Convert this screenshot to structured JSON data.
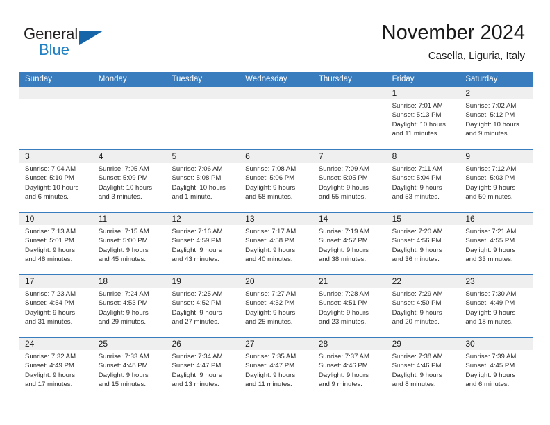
{
  "brand": {
    "name_part1": "General",
    "name_part2": "Blue",
    "logo_icon": "triangle-flag-icon"
  },
  "header": {
    "month_title": "November 2024",
    "location": "Casella, Liguria, Italy"
  },
  "theme": {
    "header_blue": "#3a7dbf",
    "brand_blue": "#1f7fc4",
    "day_band_gray": "#efefef"
  },
  "weekdays": [
    "Sunday",
    "Monday",
    "Tuesday",
    "Wednesday",
    "Thursday",
    "Friday",
    "Saturday"
  ],
  "weeks": [
    [
      {
        "day": "",
        "sunrise": "",
        "sunset": "",
        "daylight_line1": "",
        "daylight_line2": ""
      },
      {
        "day": "",
        "sunrise": "",
        "sunset": "",
        "daylight_line1": "",
        "daylight_line2": ""
      },
      {
        "day": "",
        "sunrise": "",
        "sunset": "",
        "daylight_line1": "",
        "daylight_line2": ""
      },
      {
        "day": "",
        "sunrise": "",
        "sunset": "",
        "daylight_line1": "",
        "daylight_line2": ""
      },
      {
        "day": "",
        "sunrise": "",
        "sunset": "",
        "daylight_line1": "",
        "daylight_line2": ""
      },
      {
        "day": "1",
        "sunrise": "Sunrise: 7:01 AM",
        "sunset": "Sunset: 5:13 PM",
        "daylight_line1": "Daylight: 10 hours",
        "daylight_line2": "and 11 minutes."
      },
      {
        "day": "2",
        "sunrise": "Sunrise: 7:02 AM",
        "sunset": "Sunset: 5:12 PM",
        "daylight_line1": "Daylight: 10 hours",
        "daylight_line2": "and 9 minutes."
      }
    ],
    [
      {
        "day": "3",
        "sunrise": "Sunrise: 7:04 AM",
        "sunset": "Sunset: 5:10 PM",
        "daylight_line1": "Daylight: 10 hours",
        "daylight_line2": "and 6 minutes."
      },
      {
        "day": "4",
        "sunrise": "Sunrise: 7:05 AM",
        "sunset": "Sunset: 5:09 PM",
        "daylight_line1": "Daylight: 10 hours",
        "daylight_line2": "and 3 minutes."
      },
      {
        "day": "5",
        "sunrise": "Sunrise: 7:06 AM",
        "sunset": "Sunset: 5:08 PM",
        "daylight_line1": "Daylight: 10 hours",
        "daylight_line2": "and 1 minute."
      },
      {
        "day": "6",
        "sunrise": "Sunrise: 7:08 AM",
        "sunset": "Sunset: 5:06 PM",
        "daylight_line1": "Daylight: 9 hours",
        "daylight_line2": "and 58 minutes."
      },
      {
        "day": "7",
        "sunrise": "Sunrise: 7:09 AM",
        "sunset": "Sunset: 5:05 PM",
        "daylight_line1": "Daylight: 9 hours",
        "daylight_line2": "and 55 minutes."
      },
      {
        "day": "8",
        "sunrise": "Sunrise: 7:11 AM",
        "sunset": "Sunset: 5:04 PM",
        "daylight_line1": "Daylight: 9 hours",
        "daylight_line2": "and 53 minutes."
      },
      {
        "day": "9",
        "sunrise": "Sunrise: 7:12 AM",
        "sunset": "Sunset: 5:03 PM",
        "daylight_line1": "Daylight: 9 hours",
        "daylight_line2": "and 50 minutes."
      }
    ],
    [
      {
        "day": "10",
        "sunrise": "Sunrise: 7:13 AM",
        "sunset": "Sunset: 5:01 PM",
        "daylight_line1": "Daylight: 9 hours",
        "daylight_line2": "and 48 minutes."
      },
      {
        "day": "11",
        "sunrise": "Sunrise: 7:15 AM",
        "sunset": "Sunset: 5:00 PM",
        "daylight_line1": "Daylight: 9 hours",
        "daylight_line2": "and 45 minutes."
      },
      {
        "day": "12",
        "sunrise": "Sunrise: 7:16 AM",
        "sunset": "Sunset: 4:59 PM",
        "daylight_line1": "Daylight: 9 hours",
        "daylight_line2": "and 43 minutes."
      },
      {
        "day": "13",
        "sunrise": "Sunrise: 7:17 AM",
        "sunset": "Sunset: 4:58 PM",
        "daylight_line1": "Daylight: 9 hours",
        "daylight_line2": "and 40 minutes."
      },
      {
        "day": "14",
        "sunrise": "Sunrise: 7:19 AM",
        "sunset": "Sunset: 4:57 PM",
        "daylight_line1": "Daylight: 9 hours",
        "daylight_line2": "and 38 minutes."
      },
      {
        "day": "15",
        "sunrise": "Sunrise: 7:20 AM",
        "sunset": "Sunset: 4:56 PM",
        "daylight_line1": "Daylight: 9 hours",
        "daylight_line2": "and 36 minutes."
      },
      {
        "day": "16",
        "sunrise": "Sunrise: 7:21 AM",
        "sunset": "Sunset: 4:55 PM",
        "daylight_line1": "Daylight: 9 hours",
        "daylight_line2": "and 33 minutes."
      }
    ],
    [
      {
        "day": "17",
        "sunrise": "Sunrise: 7:23 AM",
        "sunset": "Sunset: 4:54 PM",
        "daylight_line1": "Daylight: 9 hours",
        "daylight_line2": "and 31 minutes."
      },
      {
        "day": "18",
        "sunrise": "Sunrise: 7:24 AM",
        "sunset": "Sunset: 4:53 PM",
        "daylight_line1": "Daylight: 9 hours",
        "daylight_line2": "and 29 minutes."
      },
      {
        "day": "19",
        "sunrise": "Sunrise: 7:25 AM",
        "sunset": "Sunset: 4:52 PM",
        "daylight_line1": "Daylight: 9 hours",
        "daylight_line2": "and 27 minutes."
      },
      {
        "day": "20",
        "sunrise": "Sunrise: 7:27 AM",
        "sunset": "Sunset: 4:52 PM",
        "daylight_line1": "Daylight: 9 hours",
        "daylight_line2": "and 25 minutes."
      },
      {
        "day": "21",
        "sunrise": "Sunrise: 7:28 AM",
        "sunset": "Sunset: 4:51 PM",
        "daylight_line1": "Daylight: 9 hours",
        "daylight_line2": "and 23 minutes."
      },
      {
        "day": "22",
        "sunrise": "Sunrise: 7:29 AM",
        "sunset": "Sunset: 4:50 PM",
        "daylight_line1": "Daylight: 9 hours",
        "daylight_line2": "and 20 minutes."
      },
      {
        "day": "23",
        "sunrise": "Sunrise: 7:30 AM",
        "sunset": "Sunset: 4:49 PM",
        "daylight_line1": "Daylight: 9 hours",
        "daylight_line2": "and 18 minutes."
      }
    ],
    [
      {
        "day": "24",
        "sunrise": "Sunrise: 7:32 AM",
        "sunset": "Sunset: 4:49 PM",
        "daylight_line1": "Daylight: 9 hours",
        "daylight_line2": "and 17 minutes."
      },
      {
        "day": "25",
        "sunrise": "Sunrise: 7:33 AM",
        "sunset": "Sunset: 4:48 PM",
        "daylight_line1": "Daylight: 9 hours",
        "daylight_line2": "and 15 minutes."
      },
      {
        "day": "26",
        "sunrise": "Sunrise: 7:34 AM",
        "sunset": "Sunset: 4:47 PM",
        "daylight_line1": "Daylight: 9 hours",
        "daylight_line2": "and 13 minutes."
      },
      {
        "day": "27",
        "sunrise": "Sunrise: 7:35 AM",
        "sunset": "Sunset: 4:47 PM",
        "daylight_line1": "Daylight: 9 hours",
        "daylight_line2": "and 11 minutes."
      },
      {
        "day": "28",
        "sunrise": "Sunrise: 7:37 AM",
        "sunset": "Sunset: 4:46 PM",
        "daylight_line1": "Daylight: 9 hours",
        "daylight_line2": "and 9 minutes."
      },
      {
        "day": "29",
        "sunrise": "Sunrise: 7:38 AM",
        "sunset": "Sunset: 4:46 PM",
        "daylight_line1": "Daylight: 9 hours",
        "daylight_line2": "and 8 minutes."
      },
      {
        "day": "30",
        "sunrise": "Sunrise: 7:39 AM",
        "sunset": "Sunset: 4:45 PM",
        "daylight_line1": "Daylight: 9 hours",
        "daylight_line2": "and 6 minutes."
      }
    ]
  ]
}
